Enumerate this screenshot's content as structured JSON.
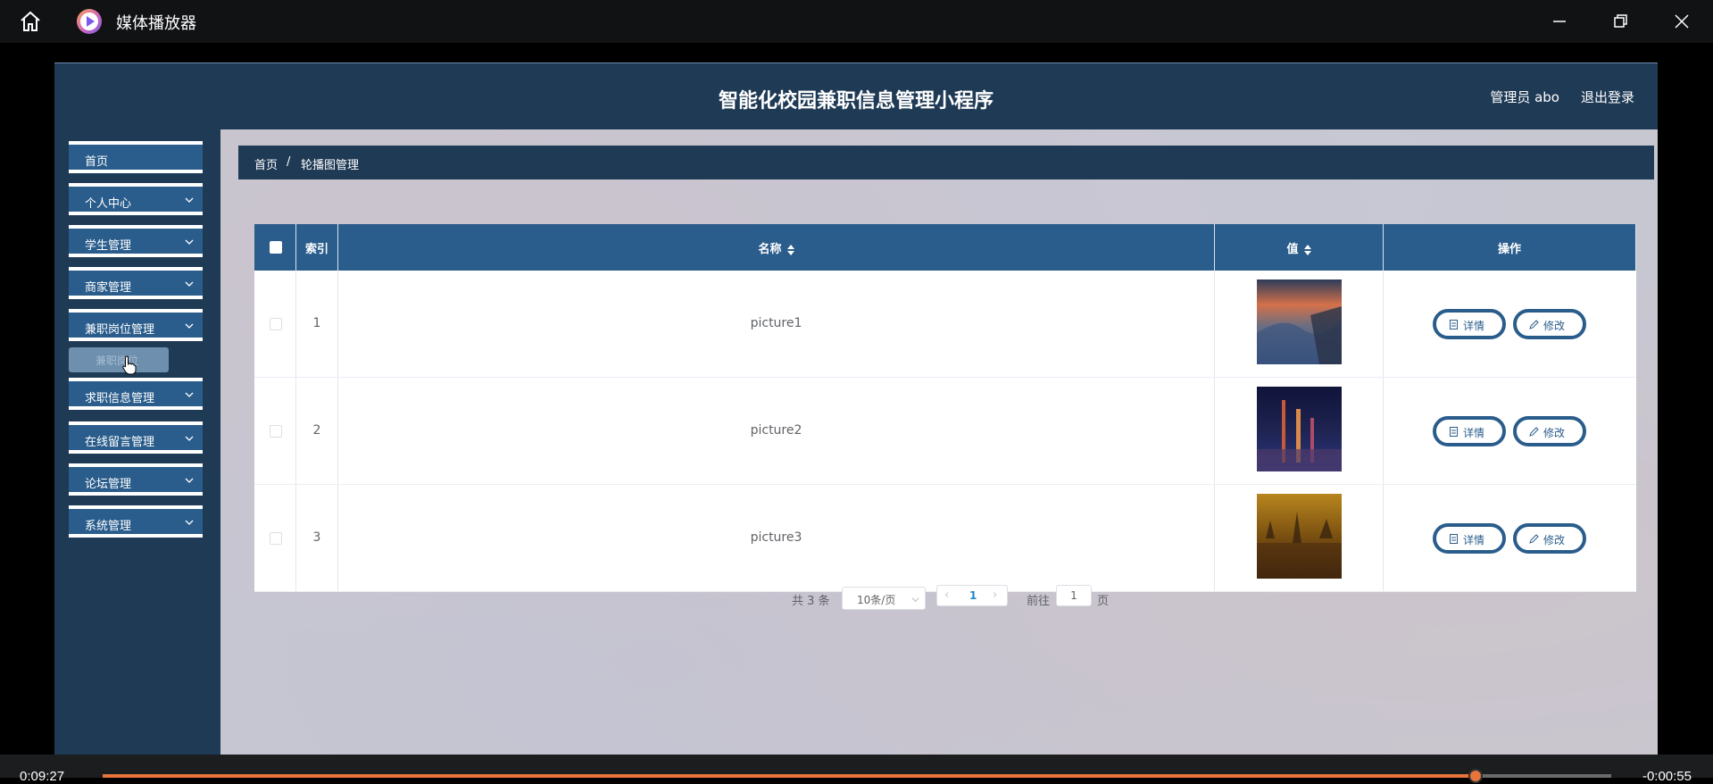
{
  "player": {
    "title": "媒体播放器",
    "time_current": "0:09:27",
    "time_remaining": "-0:00:55",
    "progress": 0.91
  },
  "header": {
    "title": "智能化校园兼职信息管理小程序",
    "admin": "管理员 abo",
    "logout": "退出登录"
  },
  "sidebar": {
    "items": [
      {
        "label": "首页"
      },
      {
        "label": "个人中心"
      },
      {
        "label": "学生管理"
      },
      {
        "label": "商家管理"
      },
      {
        "label": "兼职岗位管理"
      },
      {
        "label": "求职信息管理"
      },
      {
        "label": "在线留言管理"
      },
      {
        "label": "论坛管理"
      },
      {
        "label": "系统管理"
      }
    ],
    "sub_item": "兼职岗位"
  },
  "breadcrumb": {
    "home": "首页",
    "sep": "/",
    "current": "轮播图管理"
  },
  "table": {
    "headers": {
      "index": "索引",
      "name": "名称",
      "value": "值",
      "ops": "操作"
    },
    "rows": [
      {
        "index": "1",
        "name": "picture1"
      },
      {
        "index": "2",
        "name": "picture2"
      },
      {
        "index": "3",
        "name": "picture3"
      }
    ],
    "detail_label": "详情",
    "edit_label": "修改"
  },
  "pager": {
    "total": "共 3 条",
    "page_size": "10条/页",
    "current_page": "1",
    "goto_label": "前往",
    "goto_value": "1",
    "page_unit": "页"
  },
  "colors": {
    "primary": "#2a5d8c",
    "dark": "#1f3a55",
    "accent": "#e8743b"
  }
}
